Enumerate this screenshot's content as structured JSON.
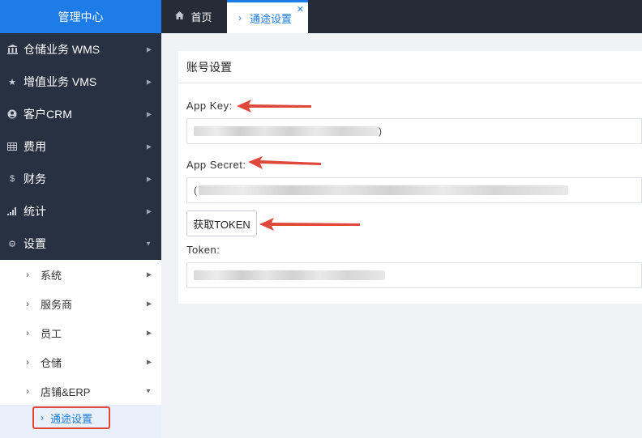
{
  "sidebar": {
    "brand": "管理中心",
    "items": [
      {
        "label": "仓储业务 WMS",
        "icon": "bank-icon",
        "glyph": "🏛"
      },
      {
        "label": "增值业务 VMS",
        "icon": "star-icon",
        "glyph": "★"
      },
      {
        "label": "客户CRM",
        "icon": "user-circle-icon",
        "glyph": "◉"
      },
      {
        "label": "费用",
        "icon": "table-icon",
        "glyph": "▦"
      },
      {
        "label": "财务",
        "icon": "dollar-icon",
        "glyph": "$"
      },
      {
        "label": "统计",
        "icon": "signal-icon",
        "glyph": "▂"
      },
      {
        "label": "设置",
        "icon": "gear-icon",
        "glyph": "⚙"
      }
    ],
    "sub_items": [
      {
        "label": "系统"
      },
      {
        "label": "服务商"
      },
      {
        "label": "员工"
      },
      {
        "label": "仓储"
      },
      {
        "label": "店铺&ERP"
      }
    ],
    "active_sub": "通途设置"
  },
  "tabs": {
    "home": "首页",
    "active": "通途设置"
  },
  "panel": {
    "title": "账号设置",
    "app_key_label": "App Key:",
    "app_key_tail": ")",
    "app_secret_label": "App Secret:",
    "app_secret_head": "(",
    "token_button": "获取TOKEN",
    "token_label": "Token:"
  },
  "colors": {
    "accent": "#1e7ce8",
    "sidebar_bg": "#273142",
    "annotation_red": "#e0483b"
  }
}
